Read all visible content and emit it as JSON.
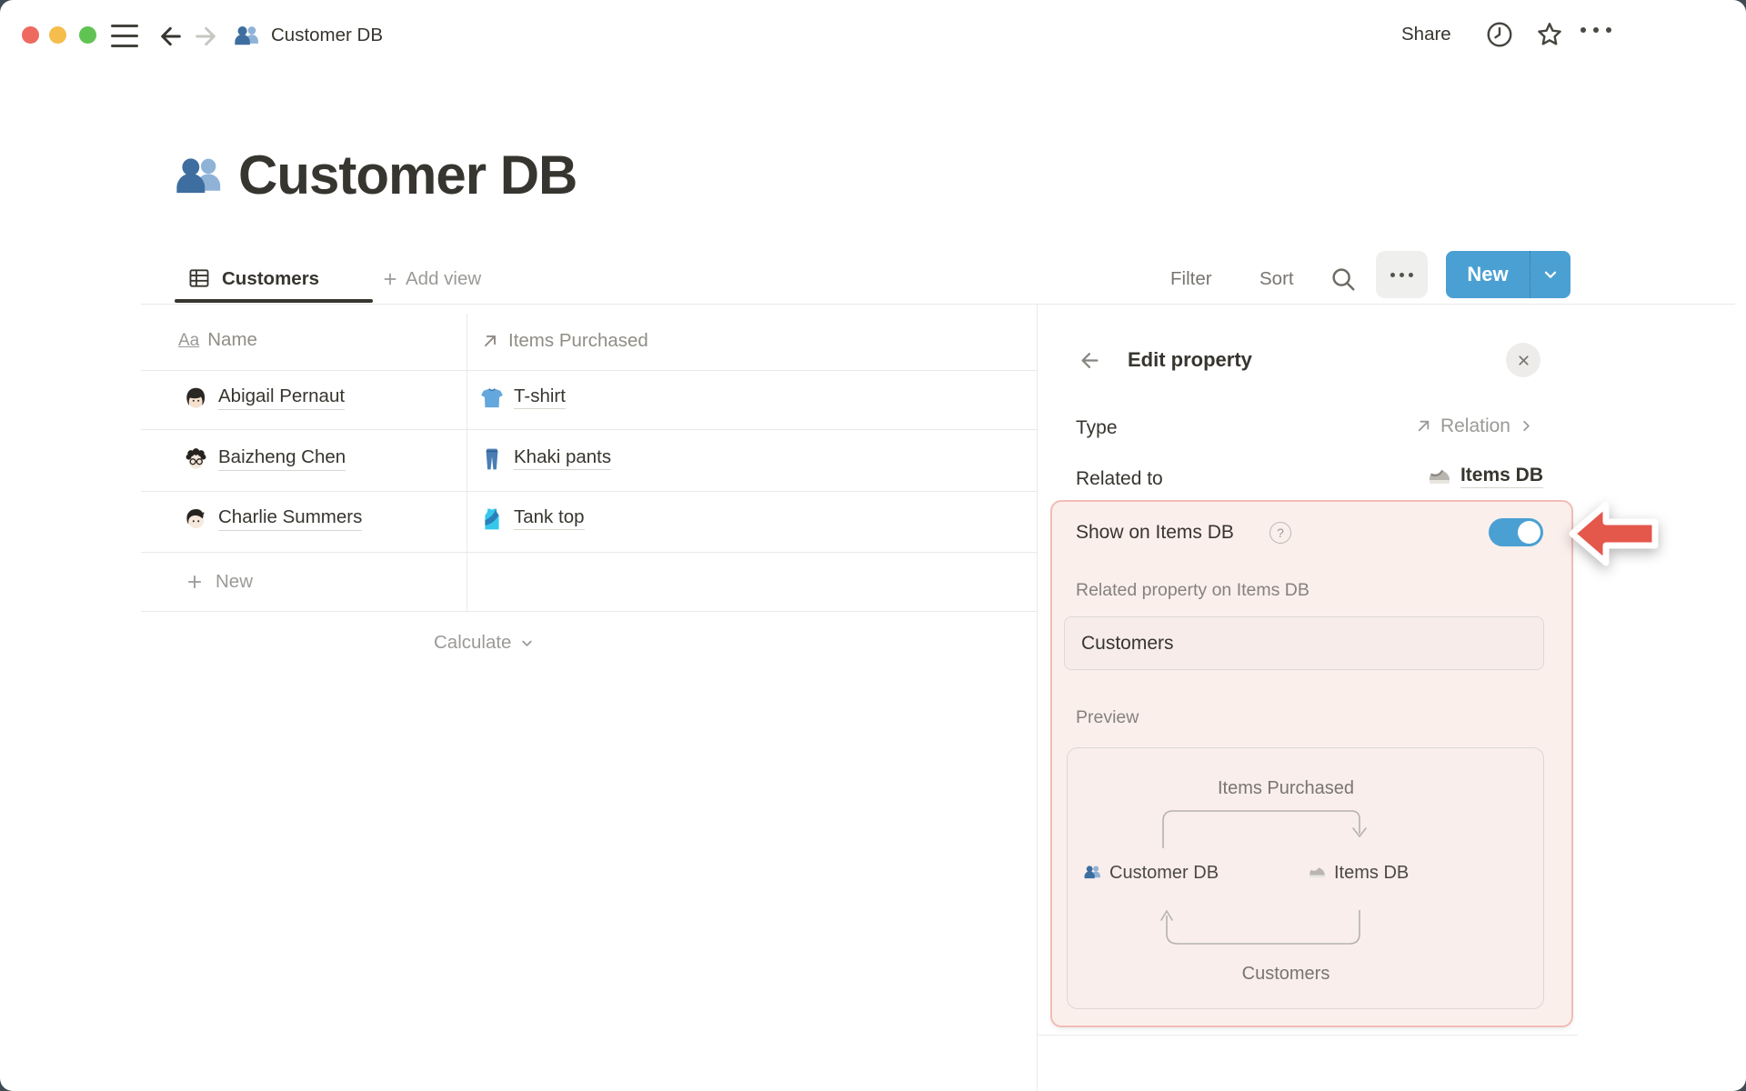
{
  "colors": {
    "accent_blue": "#4AA0D3",
    "highlight_bg": "#FBEFEC",
    "highlight_border": "#F2BCB5",
    "arrow_red": "#E4574B"
  },
  "titlebar": {
    "breadcrumb": "Customer DB",
    "share": "Share"
  },
  "page": {
    "title": "Customer DB"
  },
  "toolbar": {
    "view_tab": "Customers",
    "add_view": "Add view",
    "filter": "Filter",
    "sort": "Sort",
    "new": "New"
  },
  "table": {
    "columns": [
      {
        "icon_glyph": "Aa",
        "name": "Name"
      },
      {
        "name": "Items Purchased"
      }
    ],
    "rows": [
      {
        "name": "Abigail Pernaut",
        "item": "T-shirt"
      },
      {
        "name": "Baizheng Chen",
        "item": "Khaki pants"
      },
      {
        "name": "Charlie Summers",
        "item": "Tank top"
      }
    ],
    "new_row": "New",
    "calculate": "Calculate"
  },
  "panel": {
    "title": "Edit property",
    "type_label": "Type",
    "type_value": "Relation",
    "related_to_label": "Related to",
    "related_to_value": "Items DB",
    "show_on_label": "Show on Items DB",
    "help_glyph": "?",
    "toggle_state": "on",
    "related_property_label": "Related property on Items DB",
    "related_property_value": "Customers",
    "preview_label": "Preview",
    "preview": {
      "top_label": "Items Purchased",
      "left_node": "Customer DB",
      "right_node": "Items DB",
      "bottom_label": "Customers"
    }
  }
}
